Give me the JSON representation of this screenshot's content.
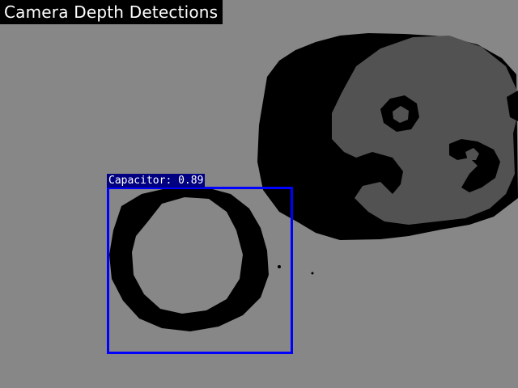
{
  "window": {
    "title": "Camera Depth Detections"
  },
  "colors": {
    "background_depth": "#878787",
    "shadow_depth": "#000000",
    "near_surface_depth": "#525252",
    "bbox_border": "#0000ff",
    "bbox_label_bg": "#000080",
    "title_bg": "#000000",
    "title_text": "#ffffff"
  },
  "detections": [
    {
      "label": "Capacitor: 0.89",
      "class_name": "Capacitor",
      "confidence": 0.89
    }
  ]
}
